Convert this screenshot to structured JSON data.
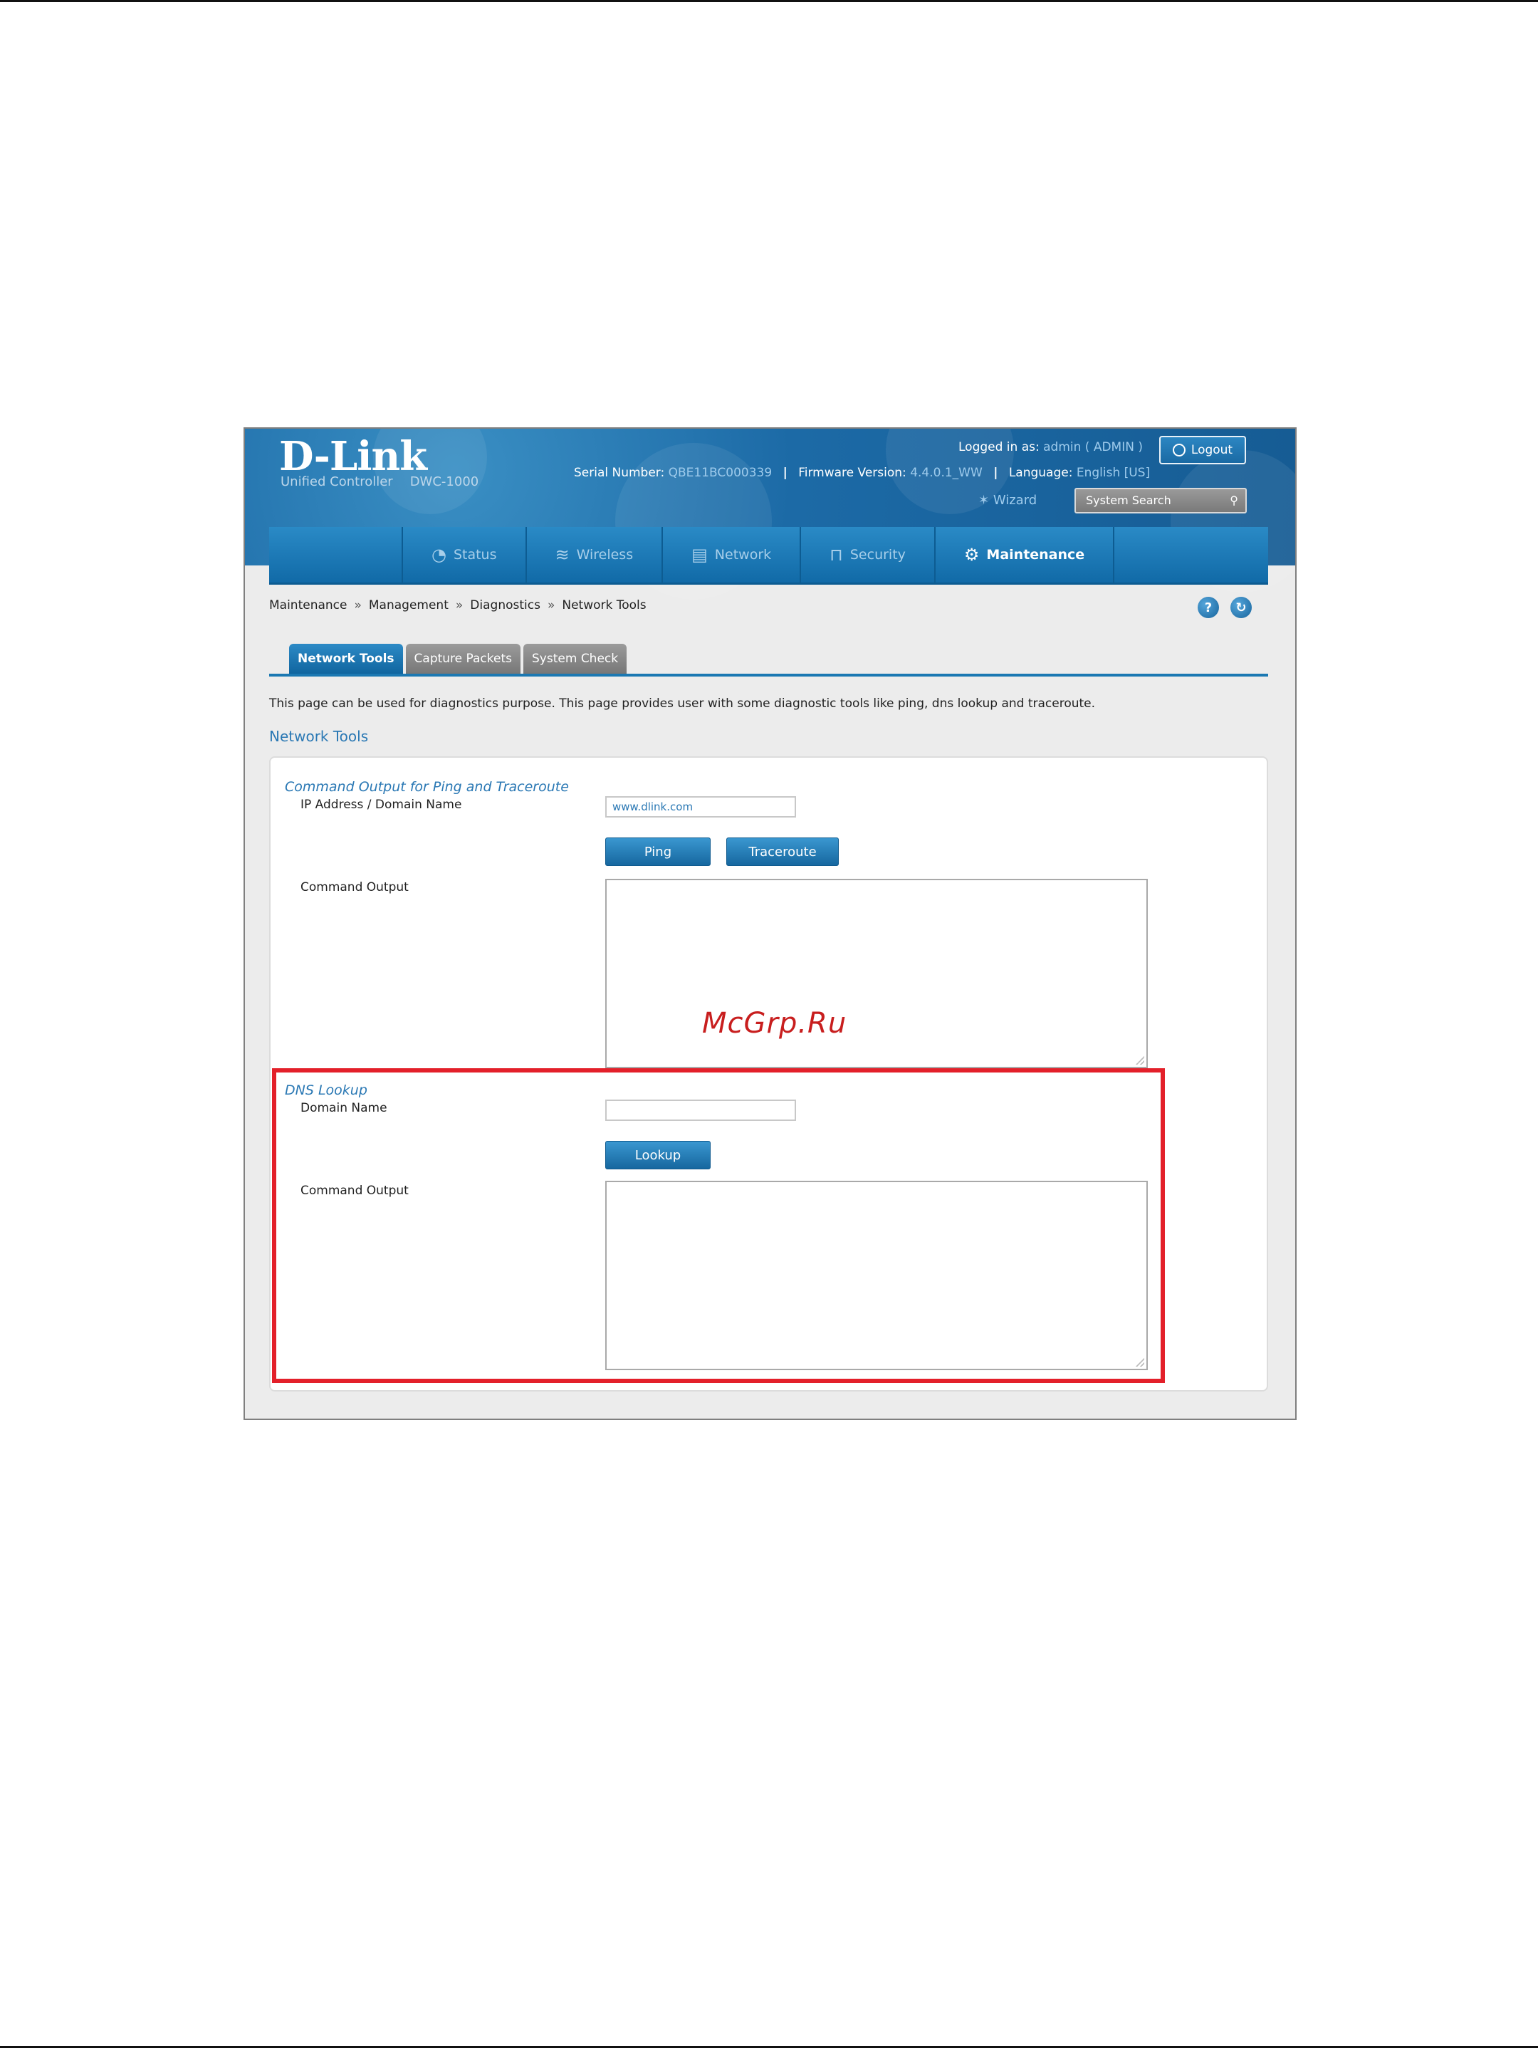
{
  "header": {
    "brand": "D-Link",
    "product_line": "Unified Controller",
    "model": "DWC-1000",
    "serial_label": "Serial Number:",
    "serial_value": "QBE11BC000339",
    "firmware_label": "Firmware Version:",
    "firmware_value": "4.4.0.1_WW",
    "language_label": "Language:",
    "language_value": "English [US]",
    "logged_in_label": "Logged in as:",
    "logged_in_value": "admin ( ADMIN )",
    "logout_label": "Logout",
    "wizard_label": "Wizard",
    "search_placeholder": "System Search"
  },
  "nav": {
    "items": [
      {
        "label": "Status",
        "icon": "speedometer-icon"
      },
      {
        "label": "Wireless",
        "icon": "wifi-icon"
      },
      {
        "label": "Network",
        "icon": "network-icon"
      },
      {
        "label": "Security",
        "icon": "lock-icon"
      },
      {
        "label": "Maintenance",
        "icon": "gears-icon",
        "active": true
      }
    ]
  },
  "breadcrumb": [
    "Maintenance",
    "Management",
    "Diagnostics",
    "Network Tools"
  ],
  "tabs": [
    "Network Tools",
    "Capture Packets",
    "System Check"
  ],
  "page": {
    "description": "This page can be used for diagnostics purpose. This page provides user with some diagnostic tools like ping, dns lookup and traceroute.",
    "section_title": "Network Tools"
  },
  "ping_group": {
    "title": "Command Output for Ping and Traceroute",
    "address_label": "IP Address / Domain Name",
    "address_value": "www.dlink.com",
    "ping_button": "Ping",
    "traceroute_button": "Traceroute",
    "output_label": "Command Output"
  },
  "dns_group": {
    "title": "DNS Lookup",
    "domain_label": "Domain Name",
    "domain_value": "",
    "lookup_button": "Lookup",
    "output_label": "Command Output"
  },
  "watermark": "McGrp.Ru",
  "colors": {
    "brand_blue": "#1c6aa6",
    "link_blue": "#2a78b4",
    "highlight_red": "#e3202a"
  }
}
